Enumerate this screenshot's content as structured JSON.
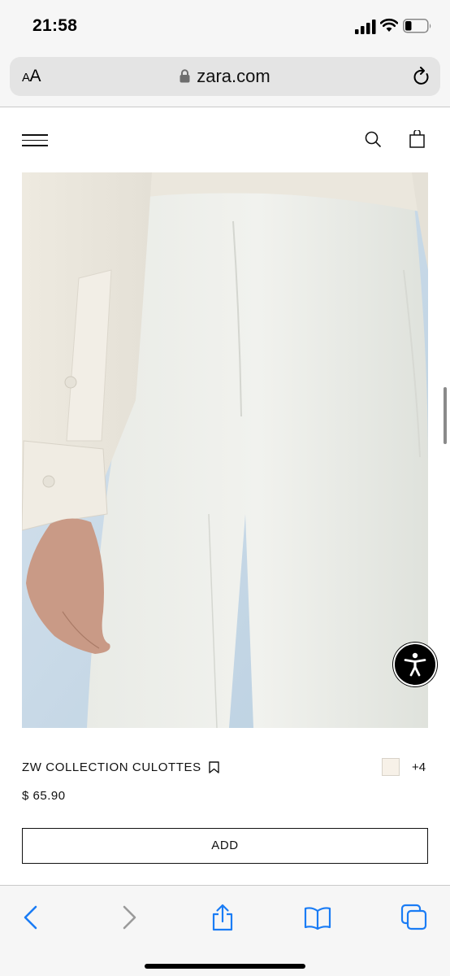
{
  "status_bar": {
    "time": "21:58",
    "signal_icon": "signal-icon",
    "wifi_icon": "wifi-icon",
    "battery_icon": "battery-icon",
    "battery_level": 0.25
  },
  "browser": {
    "text_size_label": "AA",
    "url": "zara.com",
    "lock_icon": "lock-icon",
    "reload_icon": "reload-icon"
  },
  "site_header": {
    "menu_icon": "hamburger-menu-icon",
    "search_icon": "search-icon",
    "bag_icon": "shopping-bag-icon"
  },
  "product": {
    "name": "ZW COLLECTION CULOTTES",
    "bookmark_icon": "bookmark-icon",
    "swatch_color": "#f7f1e8",
    "more_colors": "+4",
    "price": "$ 65.90",
    "add_label": "ADD"
  },
  "accessibility_icon": "accessibility-icon",
  "toolbar": {
    "back_icon": "back-chevron-icon",
    "forward_icon": "forward-chevron-icon",
    "share_icon": "share-icon",
    "bookmarks_icon": "bookmarks-book-icon",
    "tabs_icon": "tabs-icon"
  },
  "colors": {
    "ios_blue": "#1a7cf5",
    "ios_gray": "#9a9a9a",
    "background_bars": "#f6f6f6"
  }
}
